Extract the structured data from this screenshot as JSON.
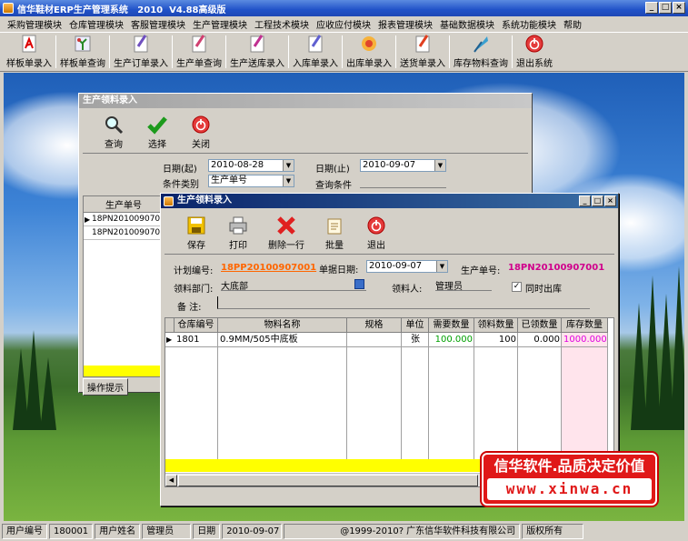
{
  "app": {
    "title": "信华鞋材ERP生产管理系统   2010  V4.88高级版",
    "window_buttons": [
      "_",
      "□",
      "×"
    ]
  },
  "menu": [
    "采购管理模块",
    "仓库管理模块",
    "客服管理模块",
    "生产管理模块",
    "工程技术模块",
    "应收应付模块",
    "报表管理模块",
    "基础数据模块",
    "系统功能模块",
    "帮助"
  ],
  "toolbar": [
    {
      "label": "样板单录入",
      "icon": "pdf-document-icon"
    },
    {
      "label": "样板单查询",
      "icon": "plant-icon"
    },
    {
      "label": "生产订单录入",
      "icon": "pen-document-icon"
    },
    {
      "label": "生产单查询",
      "icon": "pen-document-icon"
    },
    {
      "label": "生产送库录入",
      "icon": "pen-document-icon"
    },
    {
      "label": "入库单录入",
      "icon": "pen-document-icon"
    },
    {
      "label": "出库单录入",
      "icon": "flower-icon"
    },
    {
      "label": "送货单录入",
      "icon": "pen-document-icon"
    },
    {
      "label": "库存物料查询",
      "icon": "quill-icon"
    },
    {
      "label": "退出系统",
      "icon": "power-icon"
    }
  ],
  "back_window": {
    "title": "生产领料录入",
    "buttons": [
      "查询",
      "选择",
      "关闭"
    ],
    "date_from_label": "日期(起)",
    "date_from": "2010-08-28",
    "date_to_label": "日期(止)",
    "date_to": "2010-09-07",
    "condition_type_label": "条件类别",
    "condition_type": "生产单号",
    "condition_label": "查询条件",
    "condition_value": "",
    "grid_header": "生产单号",
    "rows": [
      "18PN20100907001",
      "18PN20100907002"
    ],
    "tab": "操作提示"
  },
  "front_window": {
    "title": "生产领料录入",
    "buttons": [
      "保存",
      "打印",
      "删除一行",
      "批量",
      "退出"
    ],
    "plan_no_label": "计划编号:",
    "plan_no": "18PP20100907001",
    "doc_date_label": "单据日期:",
    "doc_date": "2010-09-07",
    "prod_no_label": "生产单号:",
    "prod_no": "18PN20100907001",
    "dept_label": "领料部门:",
    "dept": "大底部",
    "picker_label": "领料人:",
    "picker": "管理员",
    "same_time_label": "同时出库",
    "same_time_checked": true,
    "remark_label": "备  注:",
    "remark": "",
    "columns": [
      "仓库编号",
      "物料名称",
      "规格",
      "单位",
      "需要数量",
      "领料数量",
      "已领数量",
      "库存数量"
    ],
    "rows": [
      {
        "warehouse": "1801",
        "name": "0.9MM/505中底板",
        "spec": "",
        "unit": "张",
        "need": "100.000",
        "take": "100",
        "taken": "0.000",
        "stock": "1000.000"
      }
    ]
  },
  "banner": {
    "line1": "信华软件.品质决定价值",
    "line2": "www.xinwa.cn"
  },
  "status": [
    "用户编号",
    "180001",
    "用户姓名",
    "管理员",
    "日期",
    "2010-09-07",
    "@1999-2010?  广东信华软件科技有限公司",
    "版权所有"
  ],
  "colors": {
    "need": "#00a000",
    "stock": "#e000e0",
    "plan_no": "#ff6600",
    "prod_no": "#d0008c",
    "title_active": "#0a246a"
  }
}
